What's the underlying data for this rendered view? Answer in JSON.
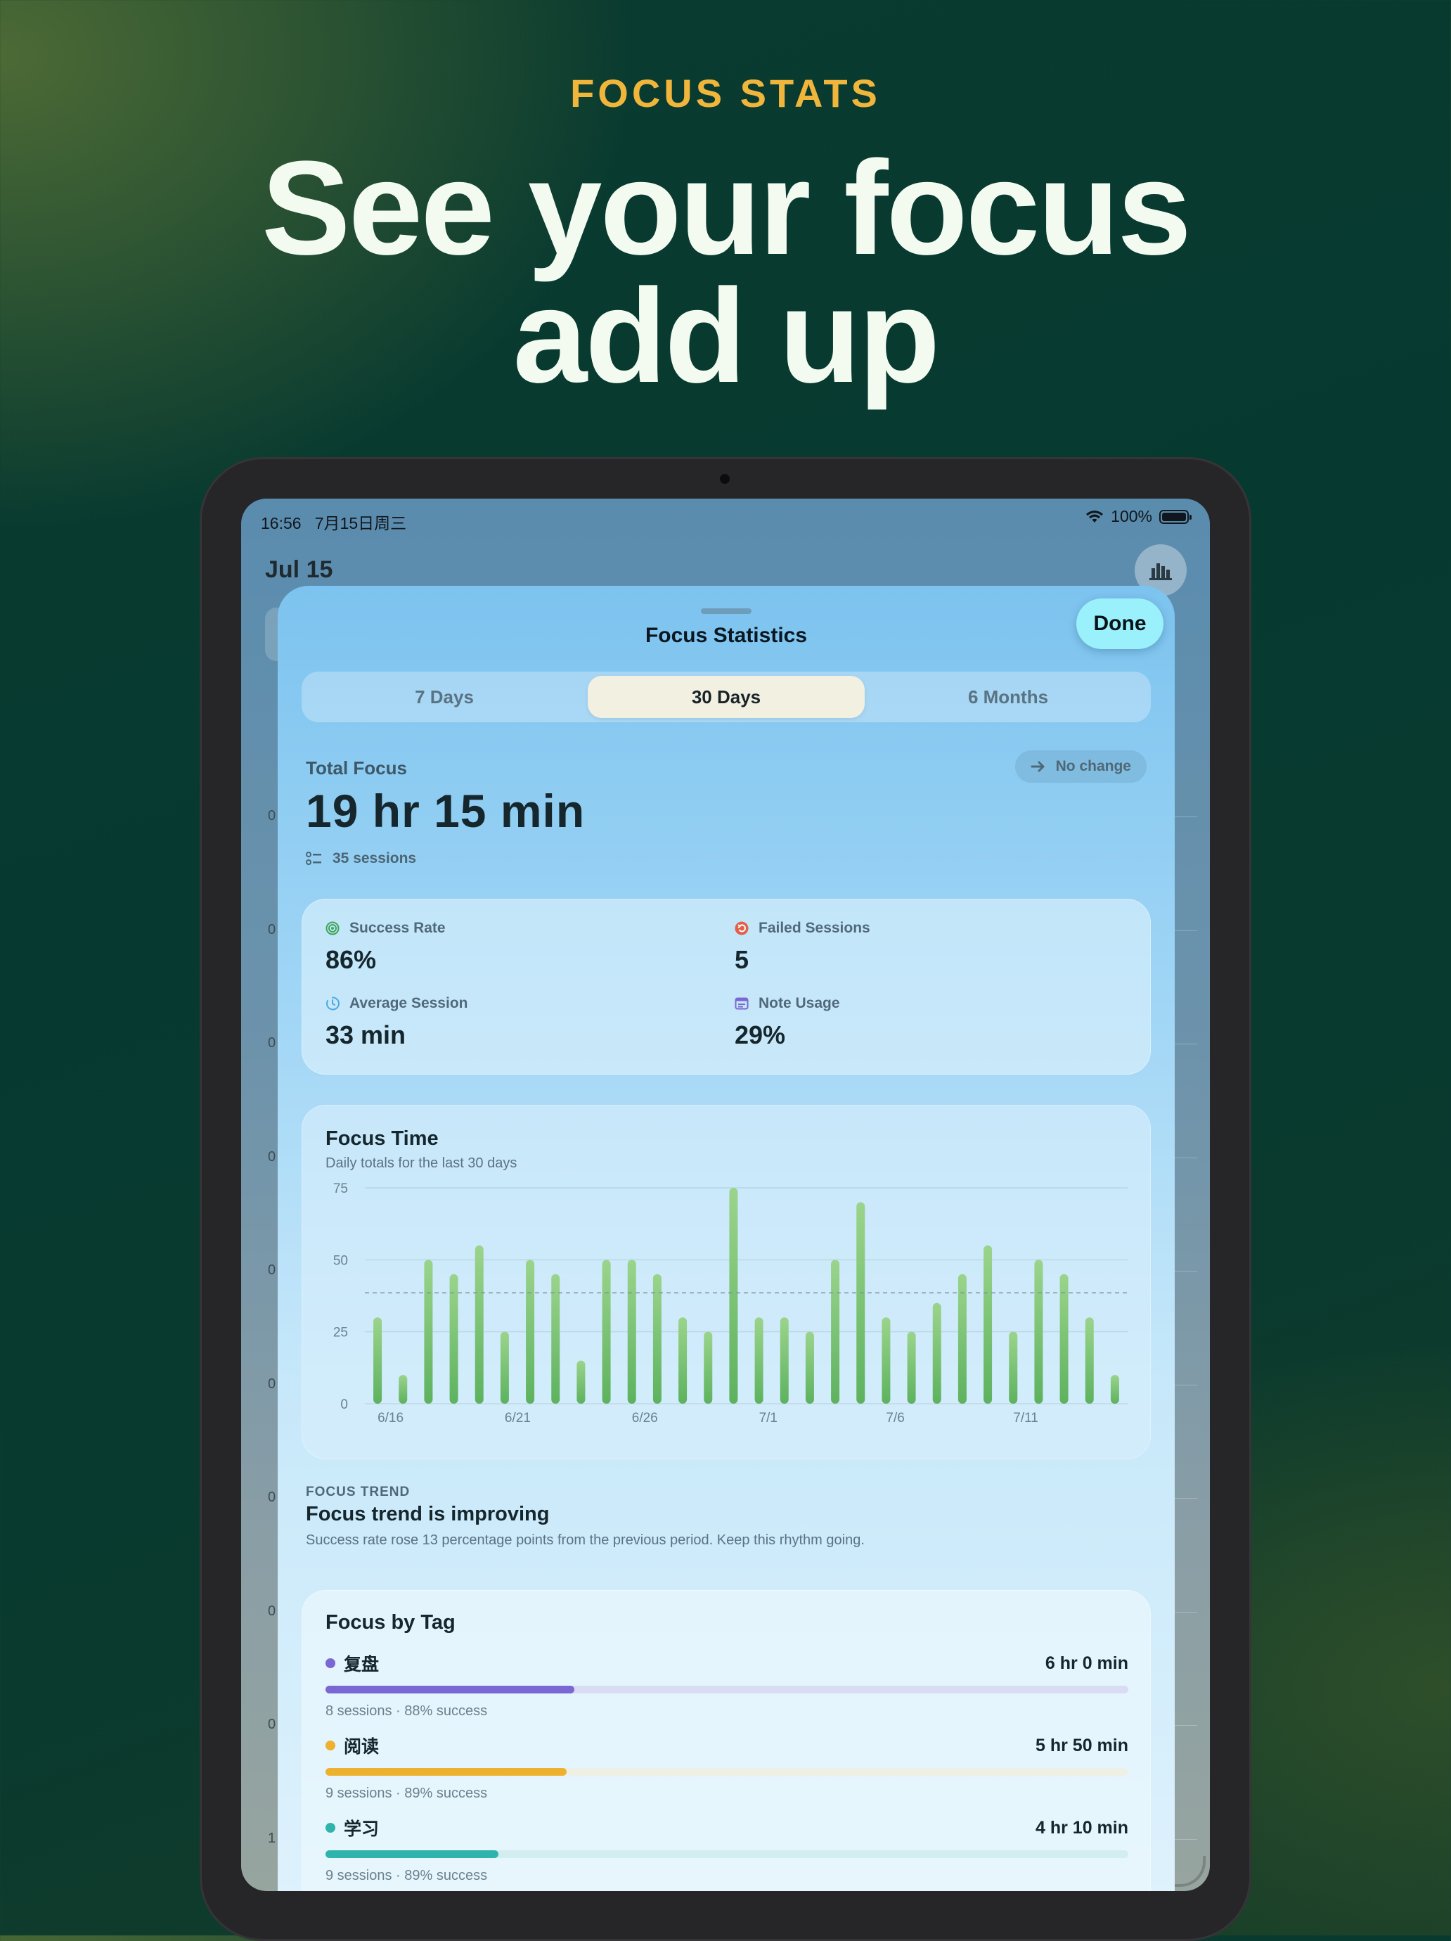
{
  "marketing": {
    "eyebrow": "FOCUS STATS",
    "headline_line1": "See your focus",
    "headline_line2": "add up"
  },
  "status_bar": {
    "time": "16:56",
    "date": "7月15日周三",
    "battery": "100%"
  },
  "background_screen": {
    "date": "Jul 15",
    "axis_labels": [
      "0",
      "0",
      "0",
      "0",
      "0",
      "0",
      "0",
      "0",
      "0",
      "1"
    ]
  },
  "sheet": {
    "title": "Focus Statistics",
    "done_label": "Done",
    "segments": [
      "7 Days",
      "30 Days",
      "6 Months"
    ],
    "selected_segment": "30 Days"
  },
  "total_focus": {
    "label": "Total Focus",
    "value": "19 hr 15 min",
    "sessions": "35 sessions",
    "change_label": "No change"
  },
  "metrics": [
    {
      "label": "Success Rate",
      "value": "86%",
      "icon": "target-icon",
      "color": "#3fa55a"
    },
    {
      "label": "Failed Sessions",
      "value": "5",
      "icon": "undo-icon",
      "color": "#e2604a"
    },
    {
      "label": "Average Session",
      "value": "33 min",
      "icon": "timer-icon",
      "color": "#49a9e0"
    },
    {
      "label": "Note Usage",
      "value": "29%",
      "icon": "note-icon",
      "color": "#7b67d3"
    }
  ],
  "focus_time": {
    "title": "Focus Time",
    "subtitle": "Daily totals for the last 30 days"
  },
  "chart_data": {
    "type": "bar",
    "title": "Focus Time",
    "subtitle": "Daily totals for the last 30 days",
    "ylim": [
      0,
      75
    ],
    "yticks": [
      0,
      25,
      50,
      75
    ],
    "x_tick_labels": [
      "6/16",
      "6/21",
      "6/26",
      "7/1",
      "7/6",
      "7/11"
    ],
    "x_tick_indices": [
      0,
      5,
      10,
      15,
      20,
      25
    ],
    "values": [
      30,
      10,
      50,
      45,
      55,
      25,
      50,
      45,
      15,
      50,
      50,
      45,
      30,
      25,
      75,
      30,
      30,
      25,
      50,
      70,
      30,
      25,
      35,
      45,
      55,
      25,
      50,
      45,
      30,
      10
    ],
    "average_line": 38.5,
    "grid": true,
    "colors": {
      "bar_top": "#9bd48c",
      "bar_bottom": "#5db25e"
    }
  },
  "trend": {
    "eyebrow": "FOCUS TREND",
    "title": "Focus trend is improving",
    "subtitle": "Success rate rose 13 percentage points from the previous period. Keep this rhythm going."
  },
  "tags": {
    "title": "Focus by Tag",
    "items": [
      {
        "name": "复盘",
        "duration": "6 hr 0 min",
        "meta": "8 sessions · 88% success",
        "color": "#7b67d3",
        "track": "#d9dcf3",
        "fraction": 0.31
      },
      {
        "name": "阅读",
        "duration": "5 hr 50 min",
        "meta": "9 sessions · 89% success",
        "color": "#eeb02f",
        "track": "#eef0e4",
        "fraction": 0.3
      },
      {
        "name": "学习",
        "duration": "4 hr 10 min",
        "meta": "9 sessions · 89% success",
        "color": "#2fb3ad",
        "track": "#d3eef1",
        "fraction": 0.215
      }
    ]
  }
}
